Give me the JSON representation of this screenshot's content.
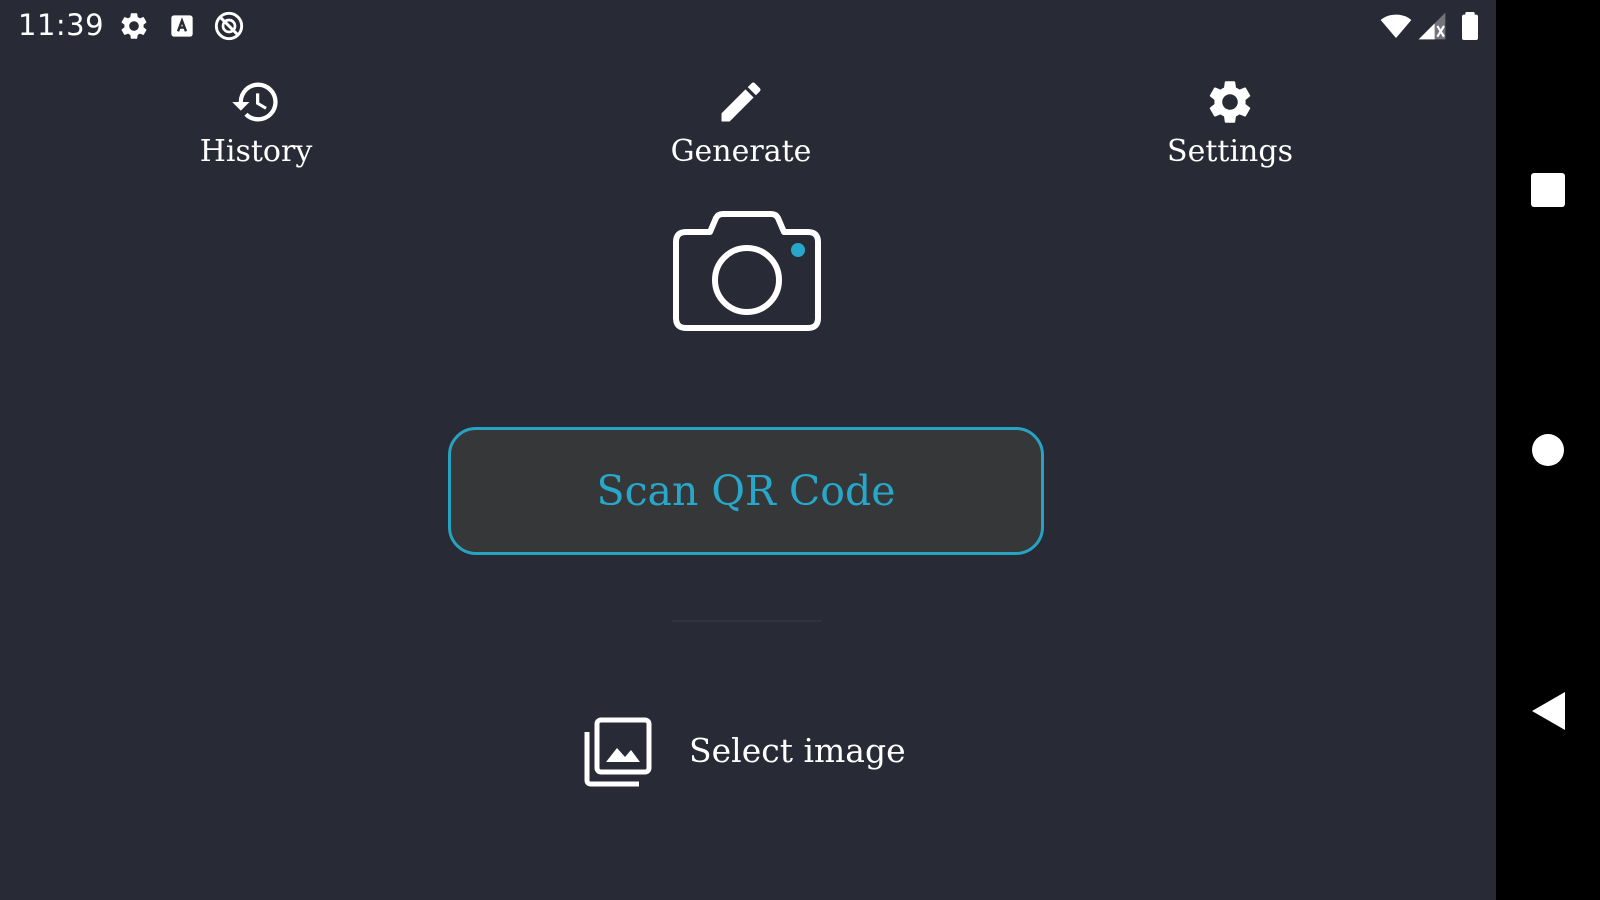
{
  "status_bar": {
    "time": "11:39",
    "left_icons": [
      "gear-icon",
      "a-badge-icon",
      "no-sync-icon"
    ],
    "right_icons": [
      "wifi-icon",
      "cellular-signal-icon",
      "battery-icon"
    ]
  },
  "top_nav": {
    "items": [
      {
        "label": "History",
        "icon": "history-icon"
      },
      {
        "label": "Generate",
        "icon": "pencil-icon"
      },
      {
        "label": "Settings",
        "icon": "gear-icon"
      }
    ]
  },
  "main": {
    "camera_icon": "camera-icon",
    "scan_button_label": "Scan QR Code",
    "select_image_label": "Select image",
    "select_image_icon": "image-library-icon"
  },
  "system_nav": {
    "buttons": [
      "recents-square-icon",
      "home-circle-icon",
      "back-triangle-icon"
    ]
  },
  "colors": {
    "background": "#282a35",
    "accent": "#27a8cb",
    "button_fill": "#363739",
    "text": "#ffffff",
    "system_bar": "#000000"
  }
}
